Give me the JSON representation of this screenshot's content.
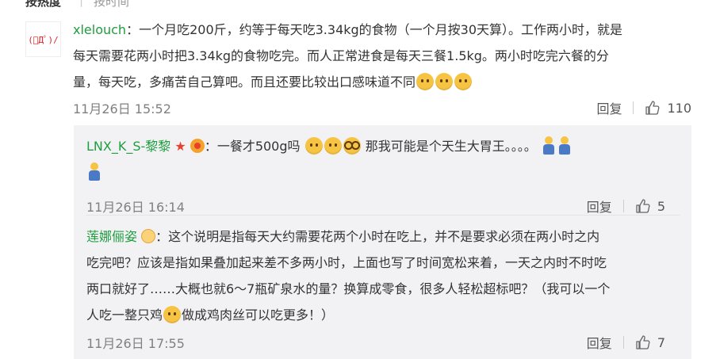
{
  "sort_bar": {
    "hot": "按热度",
    "time": "按时间"
  },
  "main_comment": {
    "avatar_text": "(ﾟДﾟ)/",
    "username": "xlelouch",
    "line1": "：一个月吃200斤，约等于每天吃3.34kg的食物（一个月按30天算）。工作两小时，就是",
    "line2": "每天需要花两小时把3.34kg的食物吃完。而人正常进食是每天三餐1.5kg。两小时吃完六餐的分",
    "line3": "量，每天吃，多痛苦自己算吧。而且还要比较出口感味道不同",
    "timestamp": "11月26日 15:52",
    "reply_label": "回复",
    "like_count": "110"
  },
  "replies": [
    {
      "username": "LNX_K_S-黎黎",
      "text_a": "：一餐才500g吗",
      "text_b": "那我可能是个天生大胃王。。。。",
      "timestamp": "11月26日 16:14",
      "reply_label": "回复",
      "like_count": "5"
    },
    {
      "username": "莲娜俪姿",
      "line1": "：这个说明是指每天大约需要花两个小时在吃上，并不是要求必须在两小时之内",
      "line2": "吃完吧？应该是指如果叠加起来差不多两小时，上面也写了时间宽松来着，一天之内时不时吃",
      "line3": "两口就好了……大概也就6～7瓶矿泉水的量？换算成零食，很多人轻松超标吧？（我可以一个",
      "line4a": "人吃一整只鸡",
      "line4b": "做成鸡肉丝可以吃更多！）",
      "timestamp": "11月26日 17:55",
      "reply_label": "回复",
      "like_count": "7"
    }
  ],
  "colors": {
    "username": "#1e9e3f",
    "text": "#333333",
    "meta": "#808080",
    "reply_bg": "#f2f2f5"
  }
}
